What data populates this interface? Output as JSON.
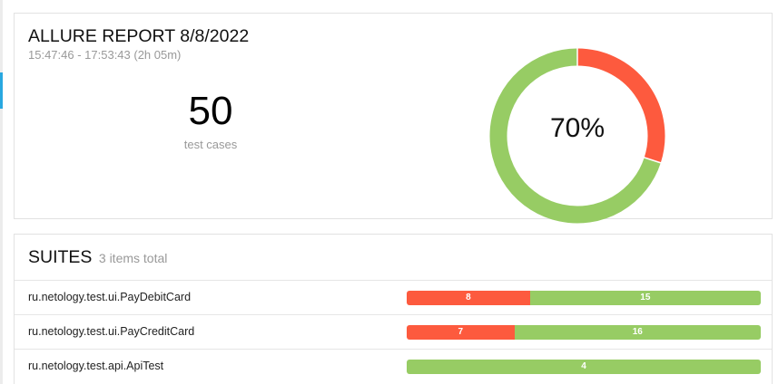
{
  "colors": {
    "failed": "#fd5a3e",
    "passed": "#97cc64"
  },
  "summary": {
    "title": "ALLURE REPORT 8/8/2022",
    "time": "15:47:46 - 17:53:43 (2h 05m)",
    "count": "50",
    "count_label": "test cases",
    "percent": "70%",
    "passed_fraction": 0.7,
    "failed_fraction": 0.3
  },
  "suites": {
    "title": "SUITES",
    "count_text": "3 items total",
    "items": [
      {
        "name": "ru.netology.test.ui.PayDebitCard",
        "failed": "8",
        "passed": "15"
      },
      {
        "name": "ru.netology.test.ui.PayCreditCard",
        "failed": "7",
        "passed": "16"
      },
      {
        "name": "ru.netology.test.api.ApiTest",
        "failed": "",
        "passed": "4"
      }
    ]
  }
}
